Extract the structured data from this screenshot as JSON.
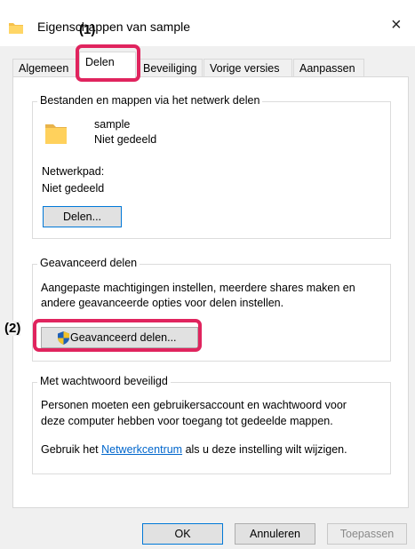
{
  "window": {
    "title": "Eigenschappen van sample",
    "close_glyph": "×"
  },
  "tabs": [
    {
      "label": "Algemeen"
    },
    {
      "label": "Delen"
    },
    {
      "label": "Beveiliging"
    },
    {
      "label": "Vorige versies"
    },
    {
      "label": "Aanpassen"
    }
  ],
  "callouts": {
    "one": "(1)",
    "two": "(2)"
  },
  "network_share": {
    "heading": "Bestanden en mappen via het netwerk delen",
    "folder_name": "sample",
    "share_status": "Niet gedeeld",
    "path_label": "Netwerkpad:",
    "path_value": "Niet gedeeld",
    "share_button": "Delen..."
  },
  "advanced": {
    "heading": "Geavanceerd delen",
    "line1": "Aangepaste machtigingen instellen, meerdere shares maken en",
    "line2": "andere geavanceerde opties voor delen instellen.",
    "button": "Geavanceerd delen..."
  },
  "password": {
    "heading": "Met wachtwoord beveiligd",
    "line1": "Personen moeten een gebruikersaccount en wachtwoord voor",
    "line2": "deze computer hebben voor toegang tot gedeelde mappen.",
    "text_before": "Gebruik het ",
    "link": "Netwerkcentrum",
    "text_after": " als u deze instelling wilt wijzigen."
  },
  "footer": {
    "ok": "OK",
    "cancel": "Annuleren",
    "apply": "Toepassen"
  },
  "colors": {
    "callout": "#e0245e",
    "link": "#0066cc",
    "focus": "#0078d7"
  },
  "icons": {
    "title": "folder-icon",
    "folder": "folder-icon",
    "shield": "shield-icon"
  }
}
